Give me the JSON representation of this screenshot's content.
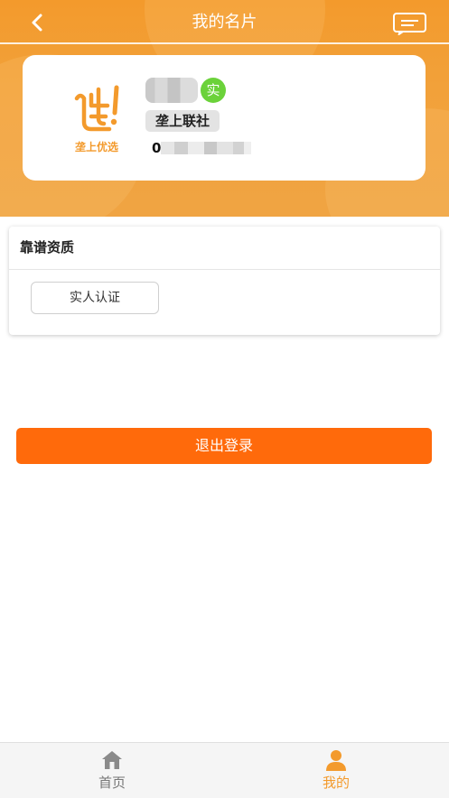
{
  "header": {
    "title": "我的名片",
    "back_icon": "chevron-left-icon",
    "message_icon": "message-icon"
  },
  "profile": {
    "logo_text": "垄上优选",
    "verified_badge": "实",
    "org_tag": "垄上联社",
    "phone_visible_prefix": "0"
  },
  "qualifications": {
    "title": "靠谱资质",
    "real_name_button": "实人认证"
  },
  "logout": {
    "label": "退出登录"
  },
  "tabbar": {
    "tabs": [
      {
        "label": "首页",
        "icon": "home-icon",
        "active": false
      },
      {
        "label": "我的",
        "icon": "user-icon",
        "active": true
      }
    ]
  },
  "colors": {
    "brand_orange": "#f39a2c",
    "logout_orange": "#ff6a0b",
    "verified_green": "#6bd23a",
    "inactive_tab": "#777777"
  }
}
